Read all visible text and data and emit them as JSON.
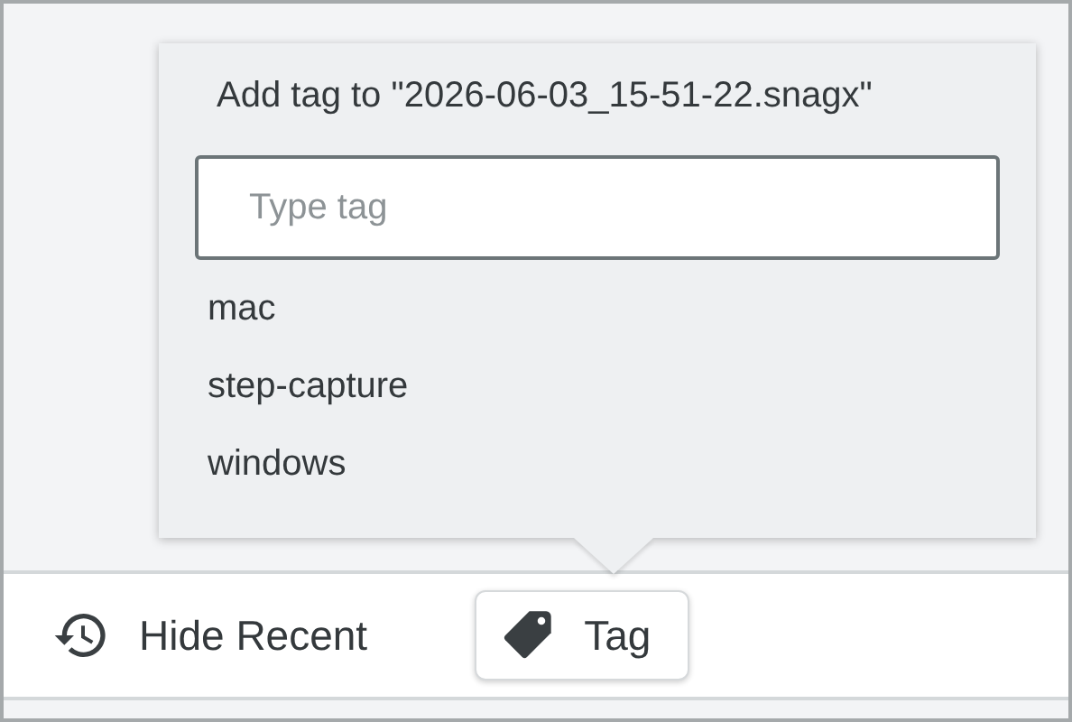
{
  "popup": {
    "title": "Add tag to \"2026-06-03_15-51-22.snagx\"",
    "input": {
      "placeholder": "Type tag"
    },
    "suggestions": [
      {
        "label": "mac"
      },
      {
        "label": "step-capture"
      },
      {
        "label": "windows"
      }
    ]
  },
  "toolbar": {
    "buttons": [
      {
        "label": "Hide Recent",
        "kind": "recent",
        "active": false
      },
      {
        "label": "Tag",
        "kind": "tag",
        "active": true
      }
    ]
  }
}
